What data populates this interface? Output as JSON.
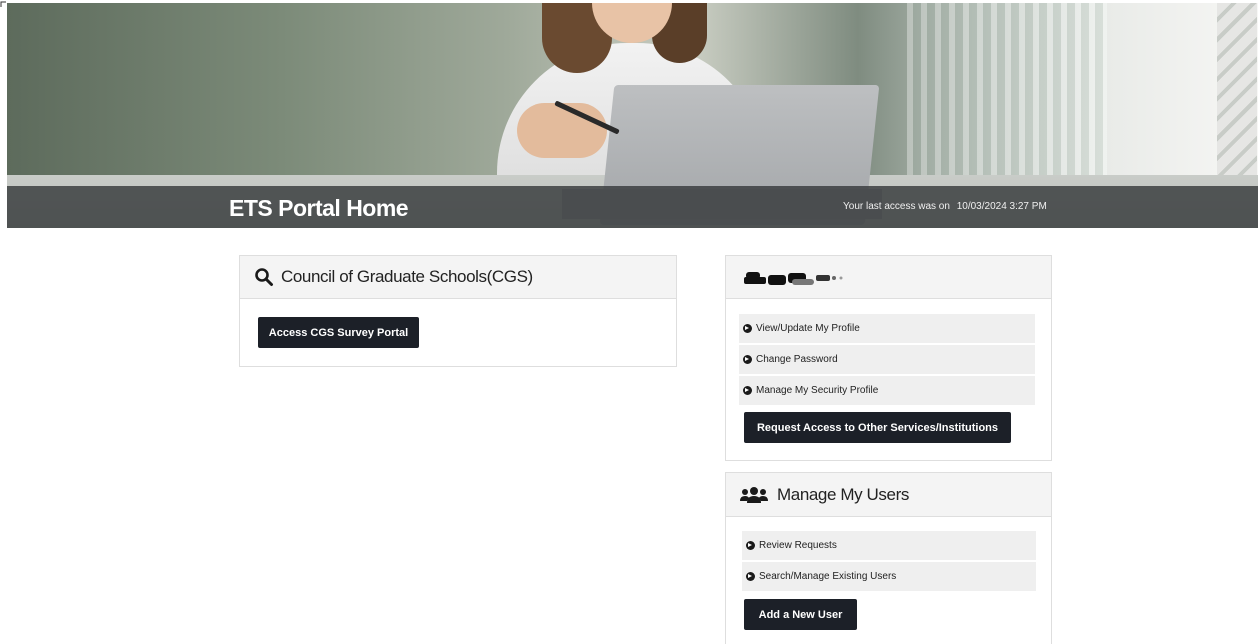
{
  "header": {
    "title": "ETS Portal Home",
    "last_access_label": "Your last access was on",
    "last_access_value": "10/03/2024 3:27 PM"
  },
  "cgs_panel": {
    "title": "Council of Graduate Schools(CGS)",
    "icon": "search-icon",
    "button_label": "Access CGS Survey Portal"
  },
  "profile_panel": {
    "title_redacted": true,
    "items": [
      {
        "label": "View/Update My Profile"
      },
      {
        "label": "Change Password"
      },
      {
        "label": "Manage My Security Profile"
      }
    ],
    "button_label": "Request Access to Other Services/Institutions"
  },
  "users_panel": {
    "title": "Manage My Users",
    "icon": "users-icon",
    "items": [
      {
        "label": "Review Requests"
      },
      {
        "label": "Search/Manage Existing Users"
      }
    ],
    "button_label": "Add a New User"
  },
  "colors": {
    "button_bg": "#1c2028",
    "title_bar": "#373a3c",
    "panel_head_bg": "#f4f4f4",
    "menu_item_bg": "#efefef"
  }
}
